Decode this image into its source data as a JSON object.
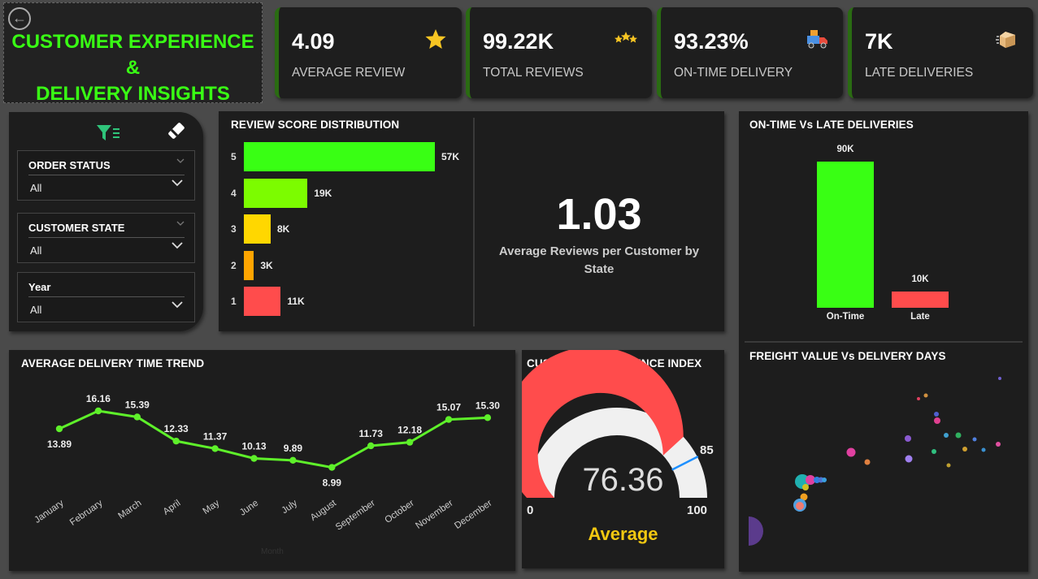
{
  "header": {
    "title_line1": "CUSTOMER EXPERIENCE &",
    "title_line2": "DELIVERY INSIGHTS",
    "back_icon": "back-arrow-icon"
  },
  "kpis": [
    {
      "value": "4.09",
      "label": "AVERAGE REVIEW",
      "icon": "star-icon"
    },
    {
      "value": "99.22K",
      "label": "TOTAL REVIEWS",
      "icon": "three-stars-icon"
    },
    {
      "value": "93.23%",
      "label": "ON-TIME DELIVERY",
      "icon": "delivery-truck-icon"
    },
    {
      "value": "7K",
      "label": "LATE DELIVERIES",
      "icon": "package-icon"
    }
  ],
  "filters": {
    "icons": [
      "filter-icon",
      "eraser-icon"
    ],
    "slicers": [
      {
        "title": "ORDER STATUS",
        "value": "All"
      },
      {
        "title": "CUSTOMER STATE",
        "value": "All"
      },
      {
        "title": "Year",
        "value": "All"
      }
    ]
  },
  "review_distribution": {
    "title": "REVIEW SCORE DISTRIBUTION",
    "chart_data": {
      "type": "bar",
      "orientation": "horizontal",
      "categories": [
        "5",
        "4",
        "3",
        "2",
        "1"
      ],
      "values": [
        57000,
        19000,
        8000,
        3000,
        11000
      ],
      "labels": [
        "57K",
        "19K",
        "8K",
        "3K",
        "11K"
      ],
      "colors": [
        "#39ff14",
        "#7cfc00",
        "#ffd700",
        "#ffa500",
        "#ff4c4c"
      ]
    },
    "card_value": "1.03",
    "card_label": "Average Reviews per Customer by State"
  },
  "delivery_status": {
    "title": "ON-TIME Vs LATE DELIVERIES",
    "chart_data": {
      "type": "bar",
      "categories": [
        "On-Time",
        "Late"
      ],
      "values": [
        90000,
        10000
      ],
      "labels": [
        "90K",
        "10K"
      ],
      "colors": [
        "#39ff14",
        "#ff4c4c"
      ]
    }
  },
  "freight": {
    "title": "FREIGHT VALUE Vs DELIVERY DAYS"
  },
  "trend": {
    "title": "AVERAGE DELIVERY TIME TREND",
    "xlabel": "Month",
    "chart_data": {
      "type": "line",
      "categories": [
        "January",
        "February",
        "March",
        "April",
        "May",
        "June",
        "July",
        "August",
        "September",
        "October",
        "November",
        "December"
      ],
      "values": [
        13.89,
        16.16,
        15.39,
        12.33,
        11.37,
        10.13,
        9.89,
        8.99,
        11.73,
        12.18,
        15.07,
        15.3
      ],
      "labels": [
        "13.89",
        "16.16",
        "15.39",
        "12.33",
        "11.37",
        "10.13",
        "9.89",
        "8.99",
        "11.73",
        "12.18",
        "15.07",
        "15.30"
      ],
      "color": "#5ef02a"
    }
  },
  "cei": {
    "title": "CUSTOMER EXPERIENCE INDEX",
    "value": "76.36",
    "rating": "Average",
    "min": "0",
    "max": "100",
    "target": "85",
    "chart_data": {
      "type": "gauge",
      "value": 76.36,
      "min": 0,
      "max": 100,
      "target": 85,
      "fill_color": "#ff4c4c",
      "track_color": "#f0f0f0",
      "target_color": "#1e90ff"
    }
  }
}
